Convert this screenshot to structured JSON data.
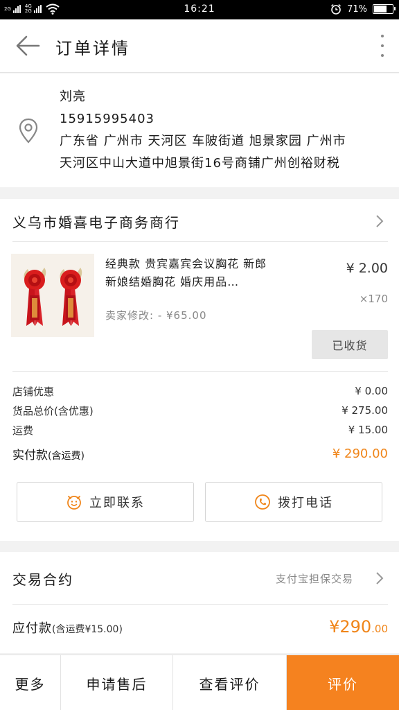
{
  "status_bar": {
    "net1": "2G",
    "net2": "4G",
    "net3": "2G",
    "time": "16:21",
    "battery": "71%",
    "battery_level": 0.71
  },
  "header": {
    "title": "订单详情"
  },
  "address": {
    "name": "刘亮",
    "phone": "15915995403",
    "line1": "广东省 广州市 天河区 车陂街道 旭景家园 广州市",
    "line2": "天河区中山大道中旭景街16号商铺广州创裕财税"
  },
  "store": {
    "name": "义乌市婚喜电子商务商行",
    "product": {
      "title": "经典款 贵宾嘉宾会议胸花 新郎新娘结婚胸花 婚庆用品…",
      "price": "¥ 2.00",
      "quantity": "×170",
      "seller_modified": "卖家修改: - ¥65.00",
      "status_button": "已收货"
    },
    "totals": [
      {
        "label": "店铺优惠",
        "value": "¥ 0.00"
      },
      {
        "label": "货品总价(含优惠)",
        "value": "¥ 275.00"
      },
      {
        "label": "运费",
        "value": "¥ 15.00"
      }
    ],
    "paid": {
      "label": "实付款",
      "sub": "(含运费)",
      "value": "¥ 290.00"
    },
    "contact_button": "立即联系",
    "call_button": "拨打电话"
  },
  "contract": {
    "title": "交易合约",
    "desc": "支付宝担保交易",
    "due_label": "应付款",
    "due_sub": "(含运费¥15.00)",
    "due_int": "¥290",
    "due_dec": ".00"
  },
  "bottom_bar": {
    "more": "更多",
    "after_sale": "申请售后",
    "view_review": "查看评价",
    "review": "评价"
  },
  "colors": {
    "accent": "#f5821f",
    "price_orange": "#f08519"
  }
}
